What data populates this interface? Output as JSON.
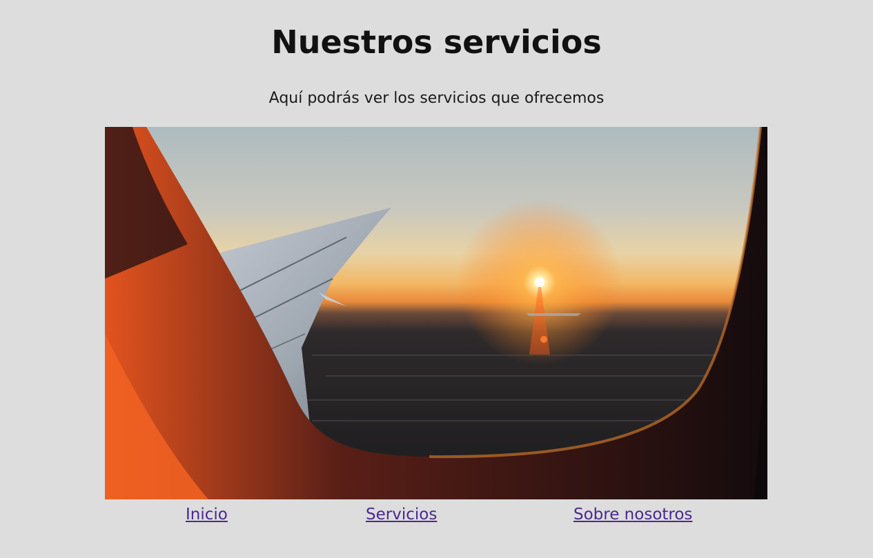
{
  "page": {
    "title": "Nuestros servicios",
    "subtitle": "Aquí podrás ver los servicios que ofrecemos"
  },
  "hero_image": {
    "icon": "airplane-window-sunset-photo"
  },
  "nav": {
    "items": [
      {
        "label": "Inicio"
      },
      {
        "label": "Servicios"
      },
      {
        "label": "Sobre nosotros"
      }
    ]
  },
  "colors": {
    "background": "#dddddd",
    "link": "#4b2790",
    "text": "#111111"
  }
}
